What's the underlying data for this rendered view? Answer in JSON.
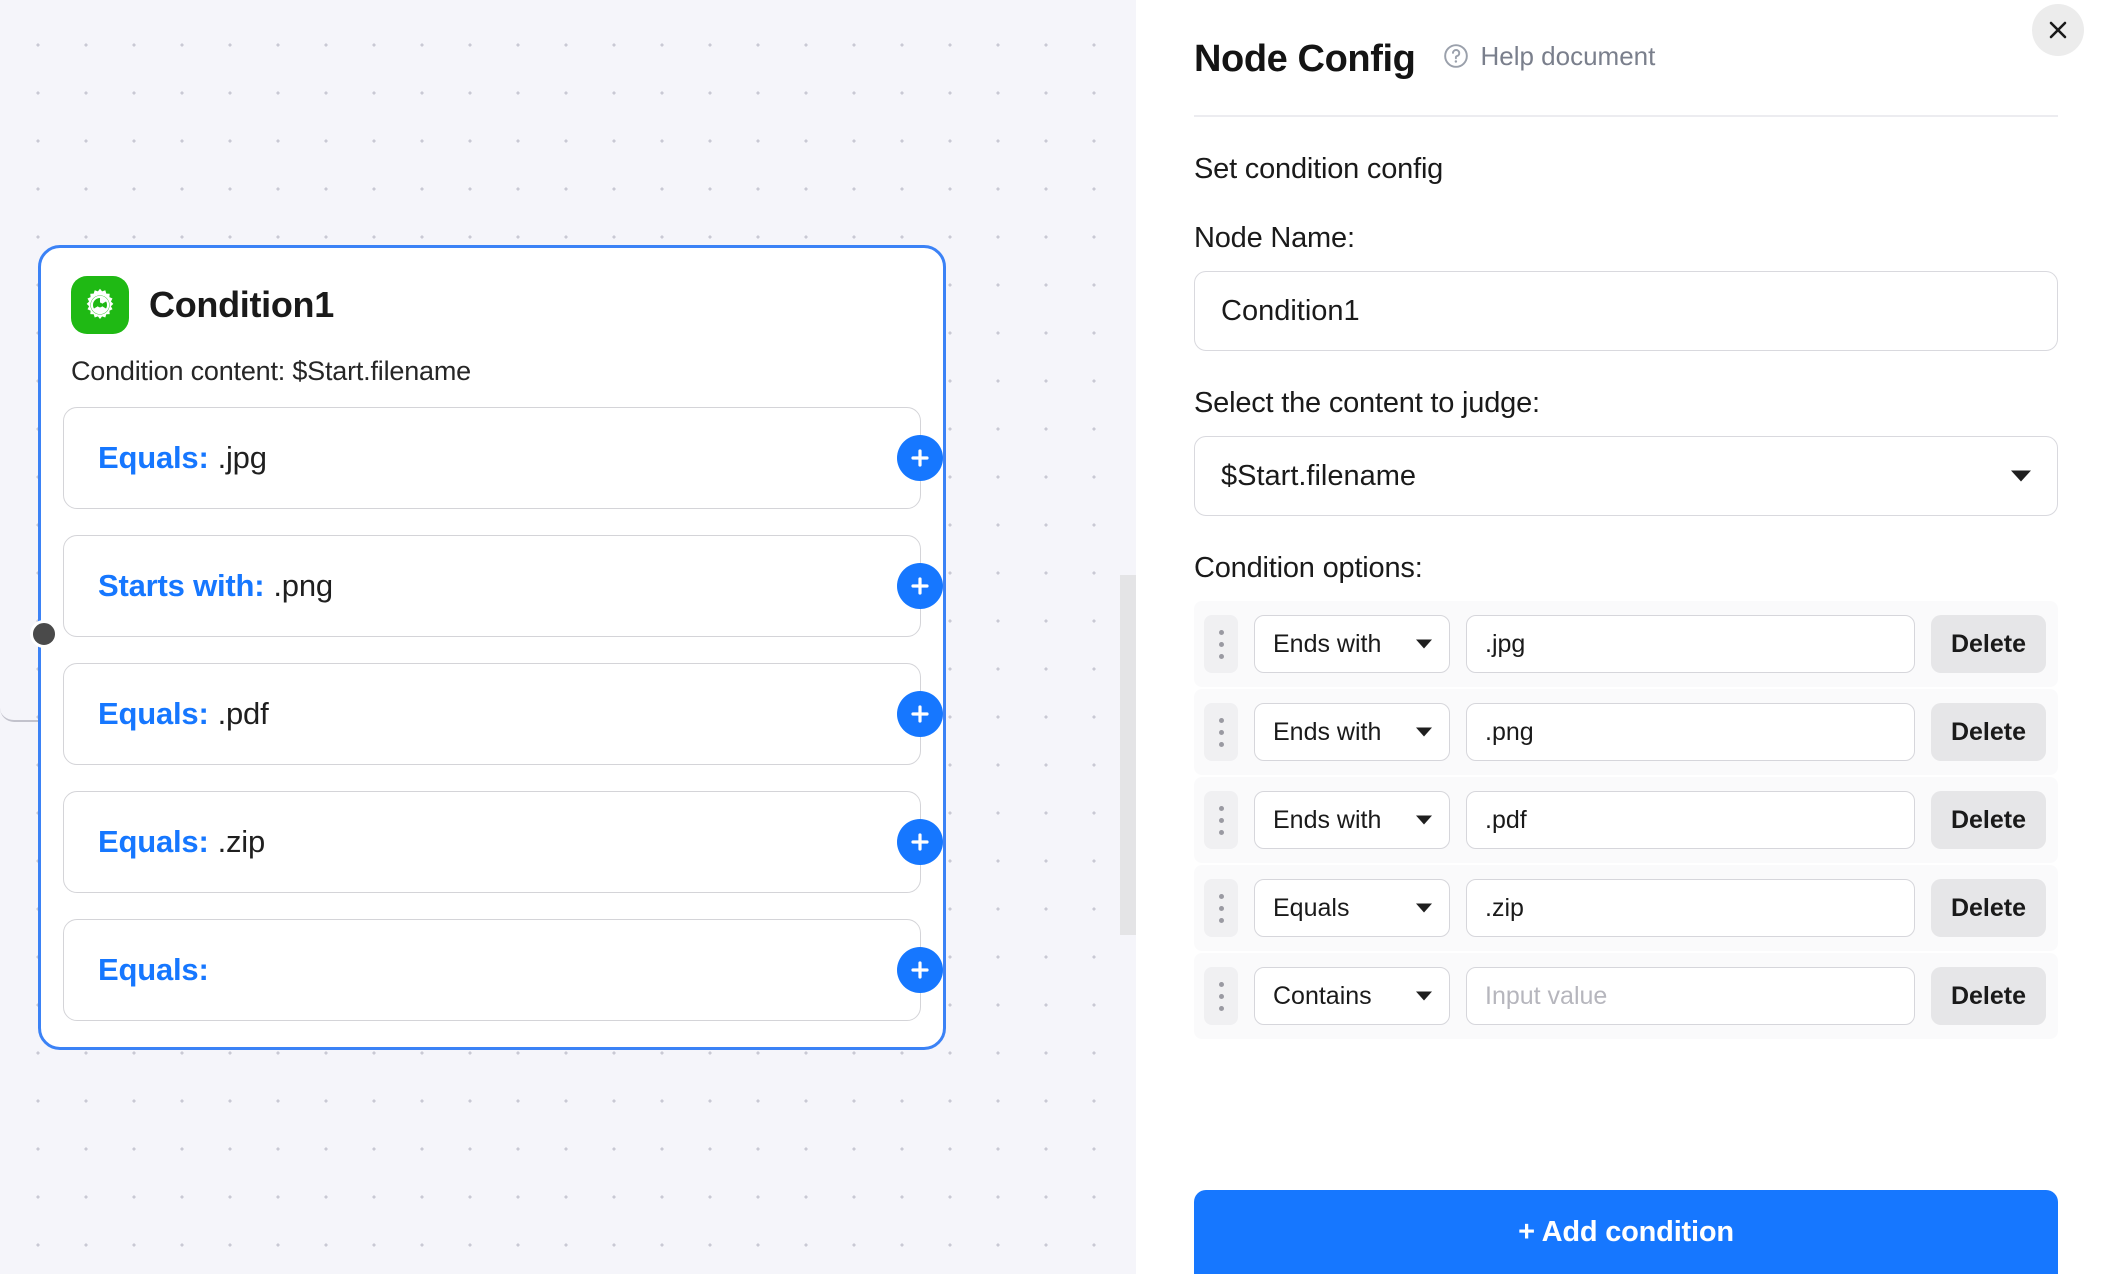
{
  "canvas": {
    "node": {
      "icon_name": "gear-icon",
      "icon_color": "#1fb914",
      "title": "Condition1",
      "subtitle": "Condition content: $Start.filename",
      "accent_color": "#3b82f6",
      "branches": [
        {
          "operator": "Equals:",
          "value": ".jpg"
        },
        {
          "operator": "Starts with:",
          "value": ".png"
        },
        {
          "operator": "Equals:",
          "value": ".pdf"
        },
        {
          "operator": "Equals:",
          "value": ".zip"
        },
        {
          "operator": "Equals:",
          "value": ""
        }
      ]
    }
  },
  "panel": {
    "title": "Node Config",
    "help_label": "Help document",
    "close_label": "×",
    "section_label": "Set condition config",
    "node_name": {
      "label": "Node Name:",
      "value": "Condition1"
    },
    "content_select": {
      "label": "Select the content to judge:",
      "value": "$Start.filename"
    },
    "condition_options": {
      "label": "Condition options:",
      "delete_label": "Delete",
      "placeholder": "Input value",
      "rows": [
        {
          "operator": "Ends with",
          "value": ".jpg"
        },
        {
          "operator": "Ends with",
          "value": ".png"
        },
        {
          "operator": "Ends with",
          "value": ".pdf"
        },
        {
          "operator": "Equals",
          "value": ".zip"
        },
        {
          "operator": "Contains",
          "value": ""
        }
      ]
    },
    "add_condition_label": "+ Add condition",
    "accent_color": "#1677ff"
  }
}
